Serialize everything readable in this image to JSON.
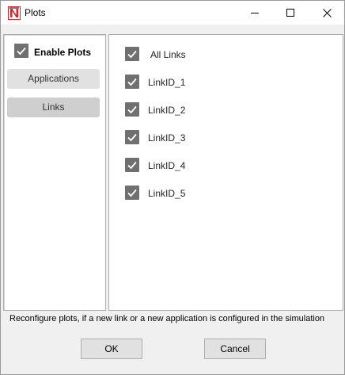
{
  "window": {
    "title": "Plots",
    "app_icon": "netsim-logo-icon",
    "controls": [
      "minimize-icon",
      "maximize-icon",
      "close-icon"
    ]
  },
  "sidebar": {
    "enable_plots": {
      "label": "Enable Plots",
      "checked": true
    },
    "items": [
      {
        "label": "Applications",
        "selected": false
      },
      {
        "label": "Links",
        "selected": true
      }
    ]
  },
  "links_panel": {
    "items": [
      {
        "label": "All Links",
        "checked": true
      },
      {
        "label": "LinkID_1",
        "checked": true
      },
      {
        "label": "LinkID_2",
        "checked": true
      },
      {
        "label": "LinkID_3",
        "checked": true
      },
      {
        "label": "LinkID_4",
        "checked": true
      },
      {
        "label": "LinkID_5",
        "checked": true
      }
    ]
  },
  "footer": {
    "info": "Reconfigure plots, if a new link or a new application is configured in the simulation",
    "ok_label": "OK",
    "cancel_label": "Cancel"
  },
  "colors": {
    "checkbox_fill": "#707070",
    "logo_red": "#d6242a",
    "nav_selected": "#cfcfcf",
    "nav_default": "#e1e1e1"
  }
}
